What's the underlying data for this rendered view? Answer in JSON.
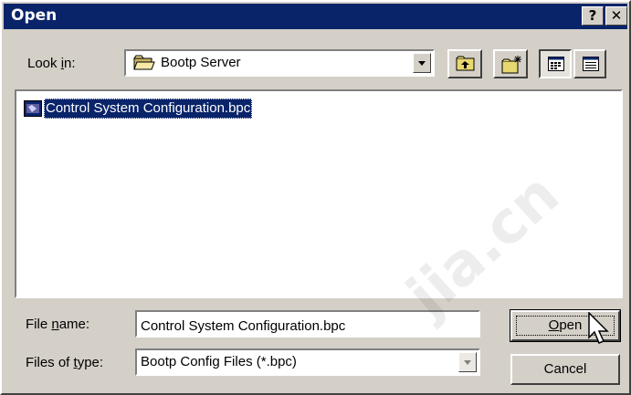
{
  "window": {
    "title": "Open",
    "help_label": "?",
    "close_label": "✕"
  },
  "look_in": {
    "label_pre": "Look ",
    "label_accel": "i",
    "label_post": "n:",
    "value": "Bootp Server"
  },
  "toolbar": {
    "buttons": [
      {
        "name": "up-one-level-button",
        "icon": "up-folder-icon"
      },
      {
        "name": "create-new-folder-button",
        "icon": "new-folder-icon"
      },
      {
        "name": "list-view-button",
        "icon": "list-view-icon",
        "pressed": true
      },
      {
        "name": "details-view-button",
        "icon": "details-view-icon",
        "pressed": false
      }
    ]
  },
  "file_list": {
    "items": [
      {
        "name": "Control System Configuration.bpc",
        "icon": "bpc-file-icon",
        "selected": true
      }
    ]
  },
  "file_name": {
    "label_pre": "File ",
    "label_accel": "n",
    "label_post": "ame:",
    "value": "Control System Configuration.bpc"
  },
  "file_type": {
    "label_pre": "Files of ",
    "label_accel": "t",
    "label_post": "ype:",
    "value": "Bootp Config Files (*.bpc)"
  },
  "buttons": {
    "open_accel": "O",
    "open_rest": "pen",
    "cancel": "Cancel"
  },
  "watermark": "jia.cn",
  "colors": {
    "face": "#d4d0c8",
    "titlebar": "#0a246a",
    "selection": "#0a246a"
  }
}
